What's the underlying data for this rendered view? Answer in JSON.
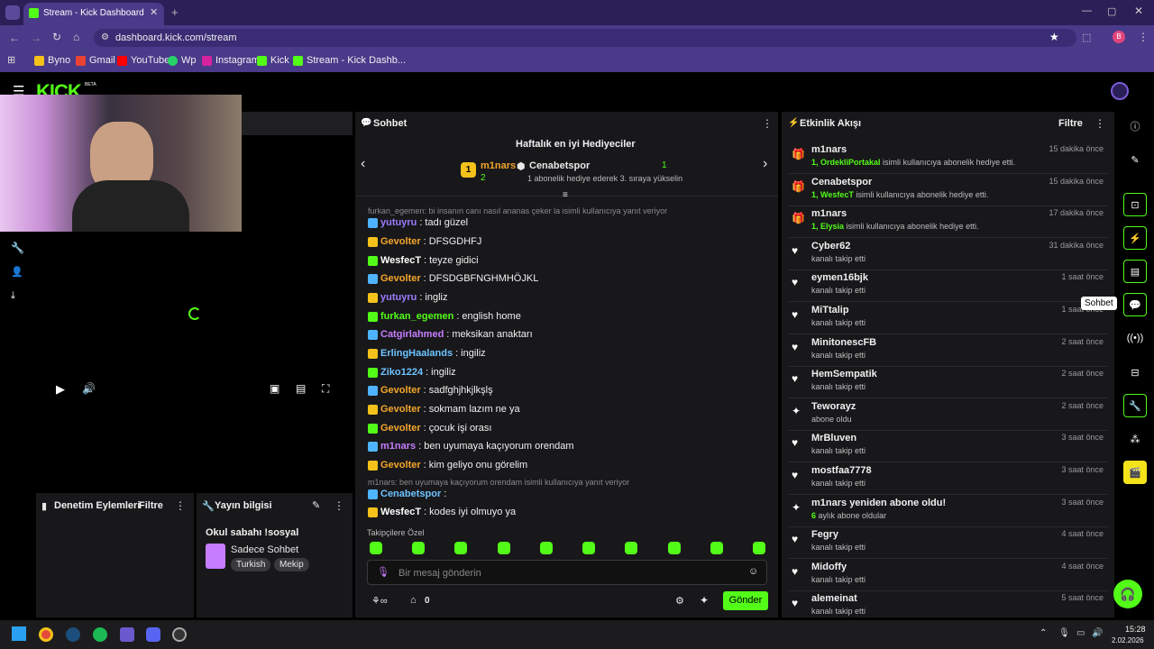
{
  "browser": {
    "tab_title": "Stream - Kick Dashboard",
    "url": "dashboard.kick.com/stream",
    "profile": "B",
    "bookmarks": [
      "Byno",
      "Gmail",
      "YouTube",
      "Wp",
      "Instagram",
      "Kick",
      "Stream - Kick Dashb..."
    ]
  },
  "brand": {
    "logo": "KICK",
    "beta": "BETA",
    "accent": "#53fc18"
  },
  "chat": {
    "title": "Sohbet",
    "top_gifters_title": "Haftalık en iyi Hediyeciler",
    "gifter1_name": "m1nars",
    "gifter1_count": "2",
    "gifter1_rank": "1",
    "gifter2_name": "Cenabetspor",
    "gifter2_count": "1",
    "gifter2_note": "1 abonelik hediye ederek 3. sıraya yükselin",
    "messages": [
      {
        "reply": "furkan_egemen: bi insanın canı nasıl ananas çeker la isimli kullanıcıya yanıt veriyor"
      },
      {
        "user": "yutuyru",
        "text": "tadı güzel",
        "color": "#9b7bff"
      },
      {
        "user": "Gevolter",
        "text": "DFSGDHFJ",
        "color": "#f4a62a"
      },
      {
        "user": "WesfecT",
        "text": "teyze gidici",
        "color": "#ffffff"
      },
      {
        "user": "Gevolter",
        "text": "DFSDGBFNGHMHÖJKL",
        "color": "#f4a62a"
      },
      {
        "user": "yutuyru",
        "text": "ingliz",
        "color": "#9b7bff"
      },
      {
        "user": "furkan_egemen",
        "text": "english home",
        "color": "#53fc18"
      },
      {
        "user": "Catgirlahmed",
        "text": "meksikan anaktarı",
        "color": "#c77dff"
      },
      {
        "user": "ErlingHaalands",
        "text": "ingiliz",
        "color": "#6ec3ff"
      },
      {
        "user": "Ziko1224",
        "text": "ingiliz",
        "color": "#6ec3ff"
      },
      {
        "user": "Gevolter",
        "text": "sadfghjhkjlkşlş",
        "color": "#f4a62a"
      },
      {
        "user": "Gevolter",
        "text": "sokmam lazım ne ya",
        "color": "#f4a62a"
      },
      {
        "user": "Gevolter",
        "text": "çocuk işi orası",
        "color": "#f4a62a"
      },
      {
        "user": "m1nars",
        "text": "ben uyumaya kaçıyorum orendam",
        "color": "#c77dff"
      },
      {
        "user": "Gevolter",
        "text": "kim geliyo onu görelim",
        "color": "#f4a62a"
      },
      {
        "reply": "m1nars: ben uyumaya kaçıyorum orendam isimli kullanıcıya yanıt veriyor"
      },
      {
        "user": "Cenabetspor",
        "text": "",
        "color": "#6ec3ff"
      },
      {
        "user": "WesfecT",
        "text": "kodes iyi olmuyo ya",
        "color": "#ffffff"
      }
    ],
    "followers_only": "Takipçilere Özel",
    "input_placeholder": "Bir mesaj gönderin",
    "send": "Gönder",
    "points": "0"
  },
  "events": {
    "title": "Etkinlik Akışı",
    "filter": "Filtre",
    "items": [
      {
        "name": "m1nars",
        "desc_hl": "1, OrdekliPortakal",
        "desc": " isimli kullanıcıya abonelik hediye etti.",
        "time": "15 dakika önce",
        "icon": "gift"
      },
      {
        "name": "Cenabetspor",
        "desc_hl": "1, WesfecT",
        "desc": " isimli kullanıcıya abonelik hediye etti.",
        "time": "15 dakika önce",
        "icon": "gift"
      },
      {
        "name": "m1nars",
        "desc_hl": "1, Elysia",
        "desc": " isimli kullanıcıya abonelik hediye etti.",
        "time": "17 dakika önce",
        "icon": "gift"
      },
      {
        "name": "Cyber62",
        "desc_hl": "",
        "desc": "kanalı takip etti",
        "time": "31 dakika önce",
        "icon": "heart"
      },
      {
        "name": "eymen16bjk",
        "desc_hl": "",
        "desc": "kanalı takip etti",
        "time": "1 saat önce",
        "icon": "heart"
      },
      {
        "name": "MiTtalip",
        "desc_hl": "",
        "desc": "kanalı takip etti",
        "time": "1 saat önce",
        "icon": "heart"
      },
      {
        "name": "MinitonescFB",
        "desc_hl": "",
        "desc": "kanalı takip etti",
        "time": "2 saat önce",
        "icon": "heart"
      },
      {
        "name": "HemSempatik",
        "desc_hl": "",
        "desc": "kanalı takip etti",
        "time": "2 saat önce",
        "icon": "heart"
      },
      {
        "name": "Teworayz",
        "desc_hl": "",
        "desc": "abone oldu",
        "time": "2 saat önce",
        "icon": "star"
      },
      {
        "name": "MrBluven",
        "desc_hl": "",
        "desc": "kanalı takip etti",
        "time": "3 saat önce",
        "icon": "heart"
      },
      {
        "name": "mostfaa7778",
        "desc_hl": "",
        "desc": "kanalı takip etti",
        "time": "3 saat önce",
        "icon": "heart"
      },
      {
        "name": "m1nars yeniden abone oldu!",
        "desc_hl": "6",
        "desc": " aylık abone oldular",
        "time": "3 saat önce",
        "icon": "star"
      },
      {
        "name": "Fegry",
        "desc_hl": "",
        "desc": "kanalı takip etti",
        "time": "4 saat önce",
        "icon": "heart"
      },
      {
        "name": "Midoffy",
        "desc_hl": "",
        "desc": "kanalı takip etti",
        "time": "4 saat önce",
        "icon": "heart"
      },
      {
        "name": "alemeinat",
        "desc_hl": "",
        "desc": "kanalı takip etti",
        "time": "5 saat önce",
        "icon": "heart"
      }
    ]
  },
  "mod": {
    "title": "Denetim Eylemleri",
    "filter": "Filtre"
  },
  "stream_info": {
    "title": "Yayın bilgisi",
    "stream_title": "Okul sabahı !sosyal",
    "category": "Sadece Sohbet",
    "tags": [
      "Turkish",
      "Mekip"
    ]
  },
  "tooltip": "Sohbet",
  "clock": {
    "time": "15:28",
    "date": "2.02.2026"
  }
}
